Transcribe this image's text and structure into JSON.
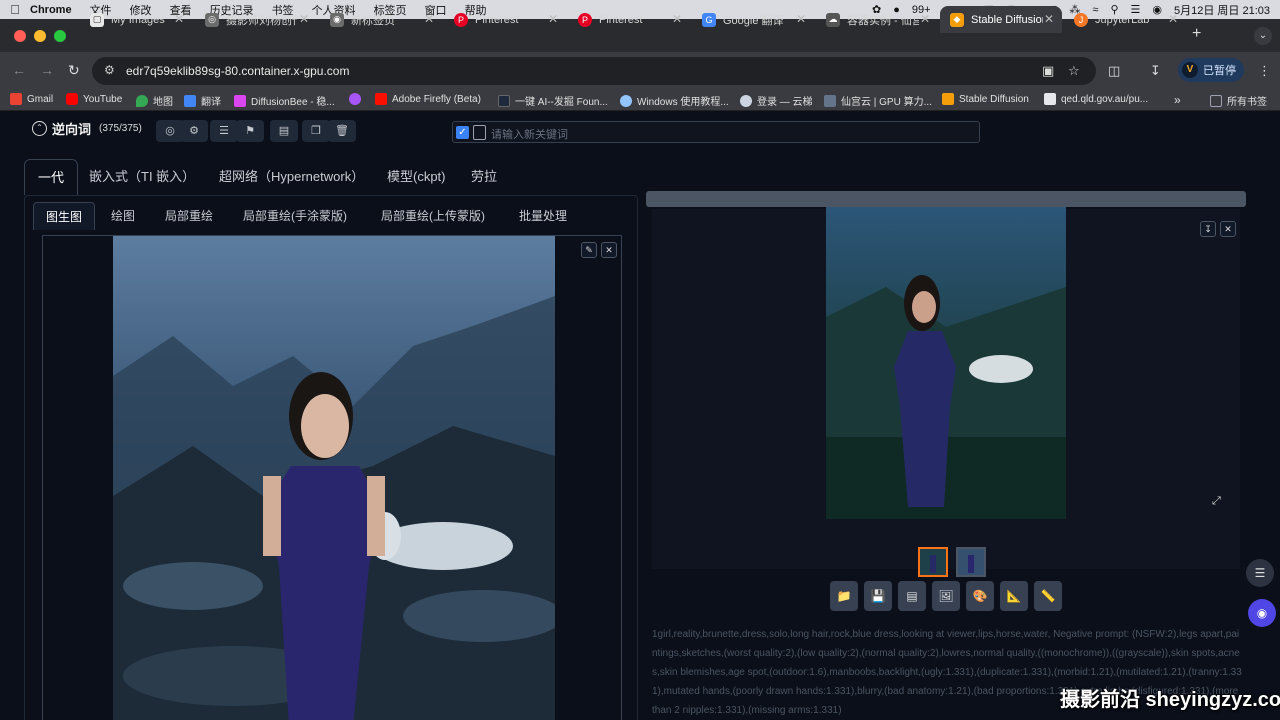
{
  "menubar": {
    "app": "Chrome",
    "items": [
      "文件",
      "修改",
      "查看",
      "历史记录",
      "书签",
      "个人资料",
      "标签页",
      "窗口",
      "帮助"
    ],
    "badge": "99+",
    "datetime": "5月12日 周日 21:03"
  },
  "tabs": [
    {
      "label": "My Images",
      "icon": "image-icon",
      "color": "#e8e8e8"
    },
    {
      "label": "摄影师刘杨创作",
      "icon": "globe-icon",
      "color": "#8a8a8a"
    },
    {
      "label": "新标签页",
      "icon": "chrome-icon",
      "color": "#8a8a8a"
    },
    {
      "label": "Pinterest",
      "icon": "pinterest-icon",
      "color": "#e60023"
    },
    {
      "label": "Pinterest",
      "icon": "pinterest-icon",
      "color": "#e60023"
    },
    {
      "label": "Google 翻译",
      "icon": "translate-icon",
      "color": "#4285f4"
    },
    {
      "label": "容器实例 - 仙宫",
      "icon": "cloud-icon",
      "color": "#555"
    },
    {
      "label": "Stable Diffusion",
      "icon": "sd-icon",
      "color": "#f59e0b"
    },
    {
      "label": "JupyterLab",
      "icon": "jupyter-icon",
      "color": "#f37726"
    }
  ],
  "address": {
    "url": "edr7q59eklib89sg-80.container.x-gpu.com"
  },
  "profile": {
    "label": "已暂停"
  },
  "bookmarks": [
    {
      "label": "Gmail",
      "color": "#ea4335"
    },
    {
      "label": "YouTube",
      "color": "#ff0000"
    },
    {
      "label": "地图",
      "color": "#34a853"
    },
    {
      "label": "翻译",
      "color": "#4285f4"
    },
    {
      "label": "DiffusionBee - 稳...",
      "color": "#d946ef"
    },
    {
      "label": "",
      "color": "#a855f7"
    },
    {
      "label": "Adobe Firefly (Beta)",
      "color": "#fa0f00"
    },
    {
      "label": "一键 AI--发掘 Foun...",
      "color": "#1e293b"
    },
    {
      "label": "Windows 使用教程...",
      "color": "#93c5fd"
    },
    {
      "label": "登录 — 云梯",
      "color": "#cbd5e1"
    },
    {
      "label": "仙宫云 | GPU 算力...",
      "color": "#64748b"
    },
    {
      "label": "Stable Diffusion",
      "color": "#f59e0b"
    },
    {
      "label": "qed.qld.gov.au/pu...",
      "color": "#e5e7eb"
    },
    {
      "label": "所有书签",
      "color": "#9ca3af"
    }
  ],
  "interrogate": {
    "title": "逆向词",
    "count": "(375/375)",
    "placeholder": "请输入新关键词"
  },
  "main_tabs": [
    "一代",
    "嵌入式（TI 嵌入）",
    "超网络（Hypernetwork）",
    "模型(ckpt)",
    "劳拉"
  ],
  "sub_tabs": [
    "图生图",
    "绘图",
    "局部重绘",
    "局部重绘(手涂蒙版)",
    "局部重绘(上传蒙版)",
    "批量处理"
  ],
  "prompt_text": "1girl,reality,brunette,dress,solo,long hair,rock,blue dress,looking at viewer,lips,horse,water, Negative prompt: (NSFW:2),legs apart,paintings,sketches,(worst quality:2),(low quality:2),(normal quality:2),lowres,normal quality,((monochrome)),((grayscale)),skin spots,acnes,skin blemishes,age spot,(outdoor:1.6),manboobs,backlight,(ugly:1.331),(duplicate:1.331),(morbid:1.21),(mutilated:1.21),(tranny:1.331),mutated hands,(poorly drawn hands:1.331),blurry,(bad anatomy:1.21),(bad proportions:1.331),extra limbs,(disfigured:1.331),(more than 2 nipples:1.331),(missing arms:1.331)",
  "watermark": "摄影前沿 sheyingzyz.com"
}
